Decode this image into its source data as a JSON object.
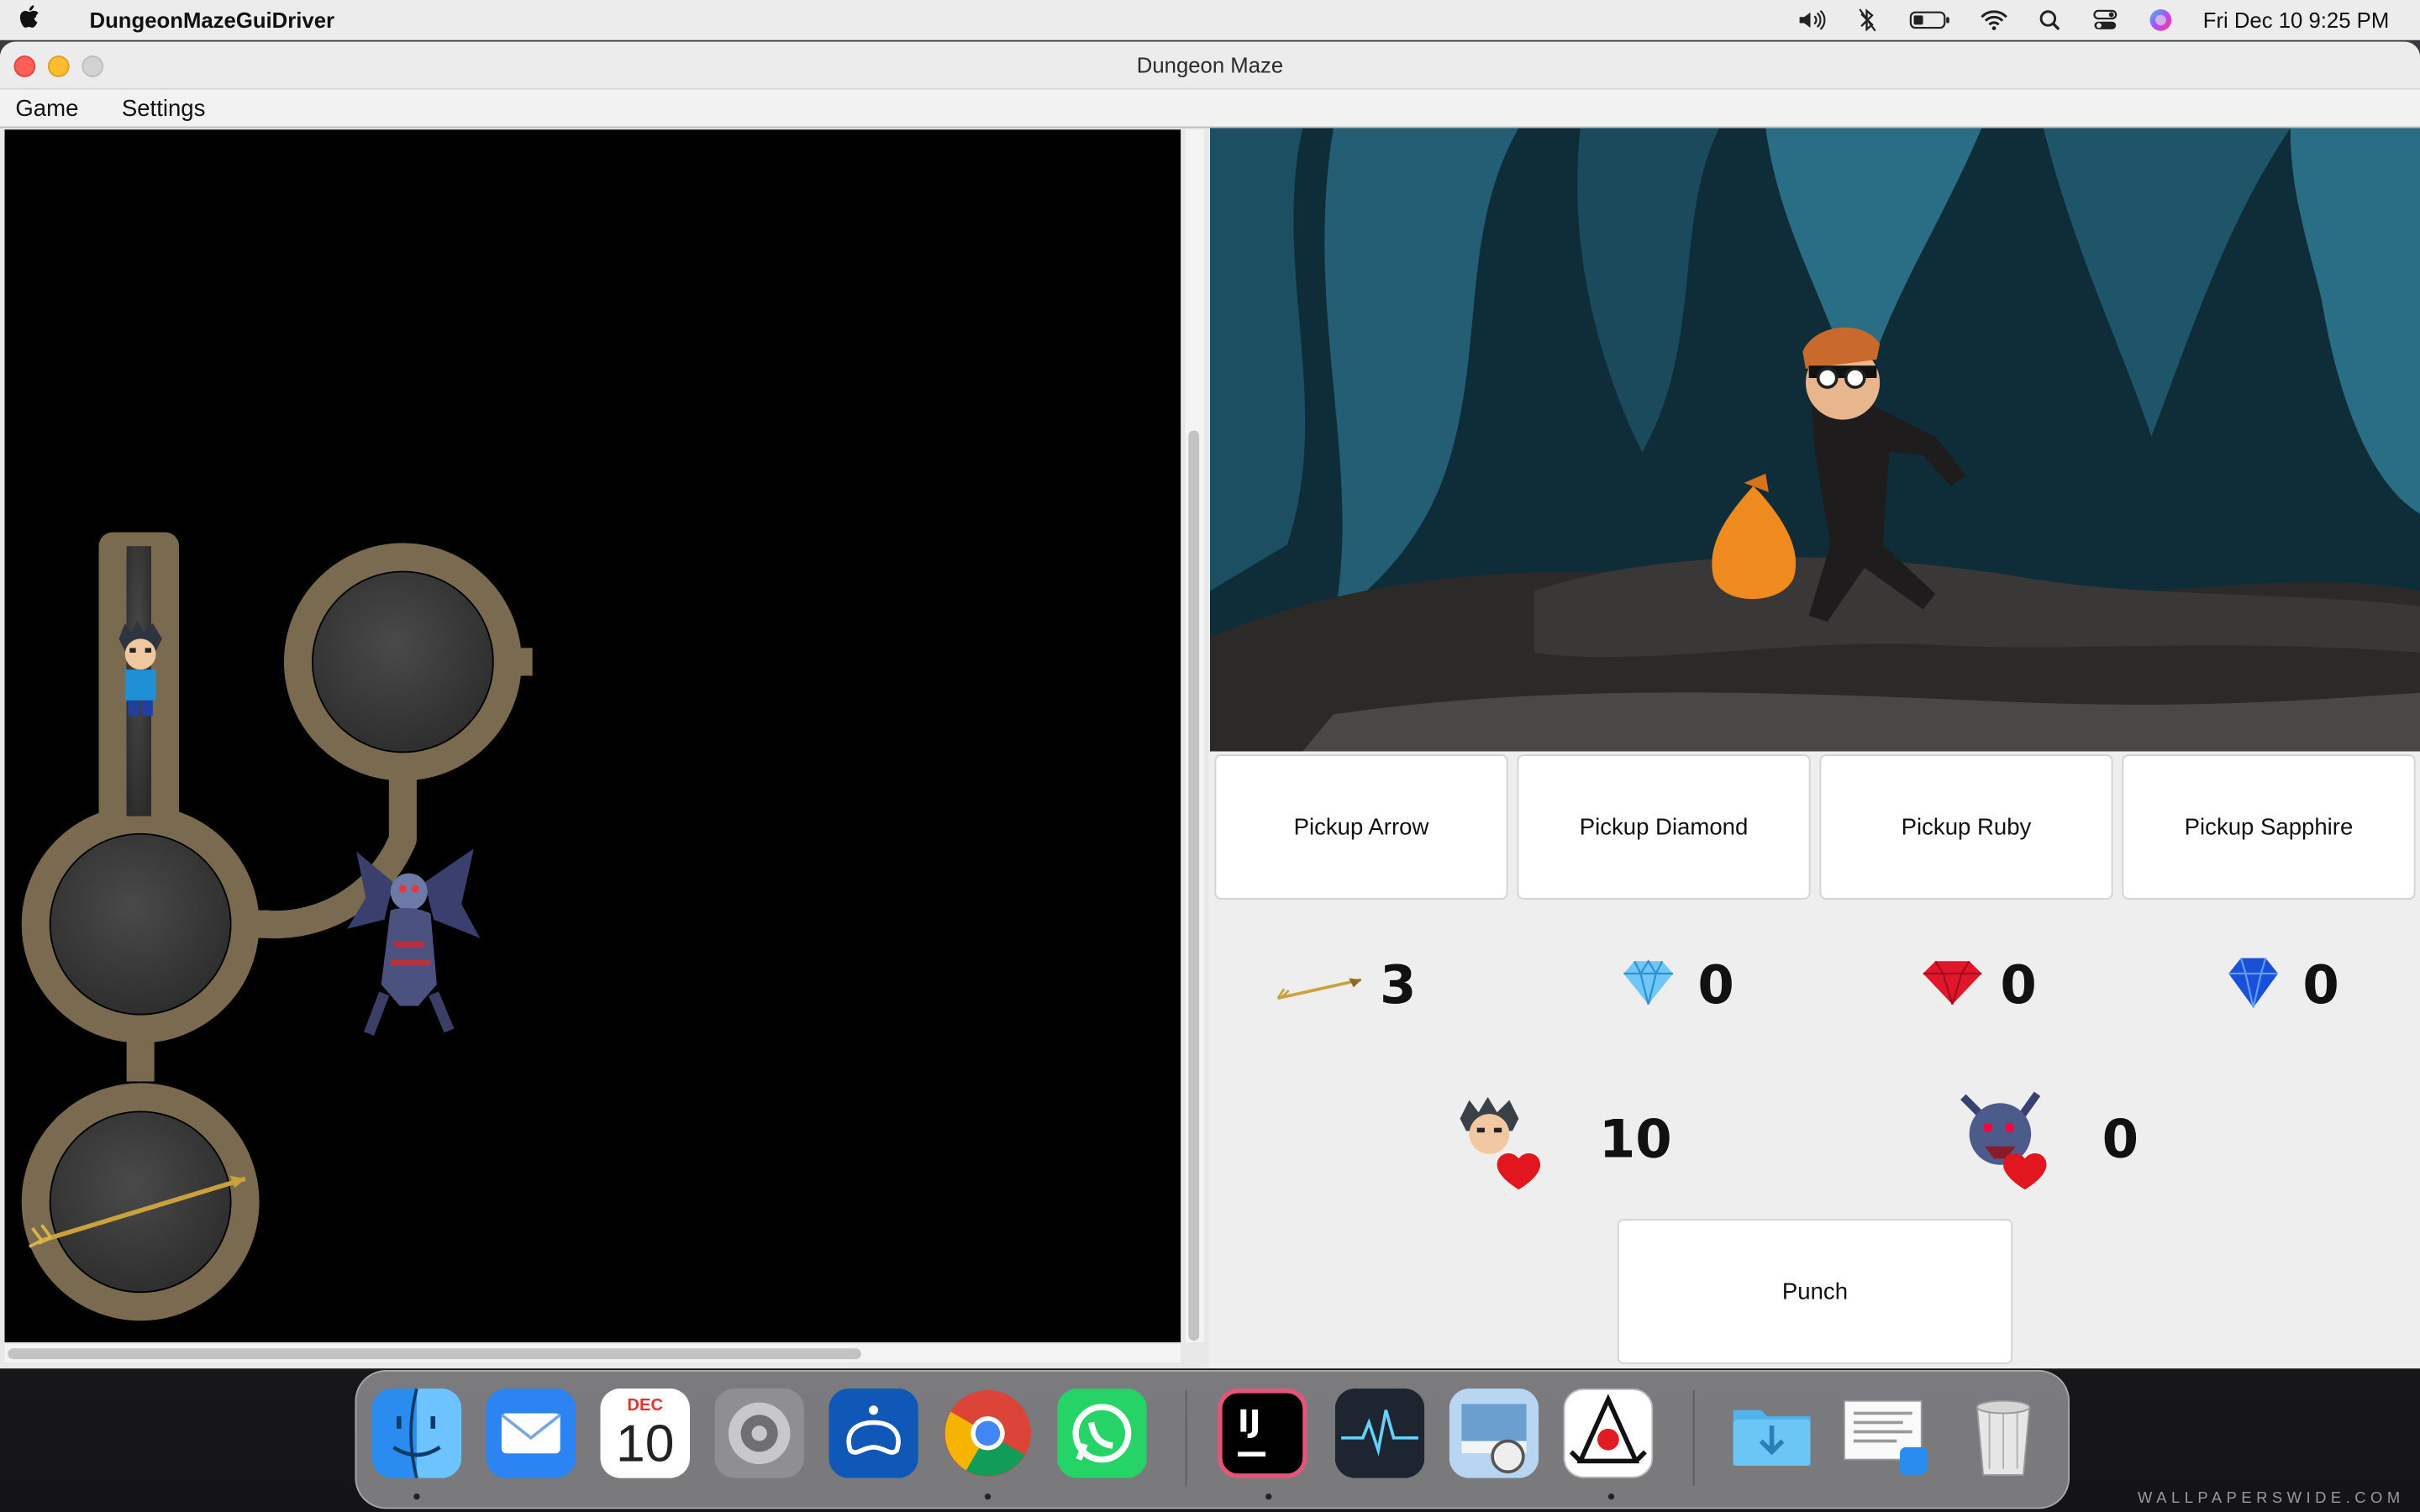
{
  "menubar": {
    "app_name": "DungeonMazeGuiDriver",
    "datetime": "Fri Dec 10  9:25 PM",
    "tray_icons": [
      "volume-icon",
      "bluetooth-icon",
      "battery-icon",
      "wifi-icon",
      "search-icon",
      "control-center-icon",
      "siri-icon"
    ]
  },
  "window": {
    "title": "Dungeon Maze",
    "menu": [
      "Game",
      "Settings"
    ]
  },
  "actions": {
    "pickup_arrow": "Pickup Arrow",
    "pickup_diamond": "Pickup Diamond",
    "pickup_ruby": "Pickup Ruby",
    "pickup_sapphire": "Pickup Sapphire",
    "punch": "Punch"
  },
  "inventory": {
    "arrows": "3",
    "diamonds": "0",
    "rubies": "0",
    "sapphires": "0"
  },
  "health": {
    "hero": "10",
    "monster": "0"
  },
  "dock": {
    "apps": [
      "Finder",
      "Mail",
      "Calendar",
      "System Preferences",
      "Steam Link",
      "Chrome",
      "WhatsApp",
      "IntelliJ IDEA",
      "Activity Monitor",
      "Preview",
      "Java",
      "Downloads Folder",
      "Documents Stack",
      "Trash"
    ],
    "calendar_month": "DEC",
    "calendar_day": "10",
    "intellij_label": "IJ"
  },
  "watermark": "WALLPAPERSWIDE.COM",
  "colors": {
    "menubar": "#ececec",
    "maze_bg": "#000000",
    "cave_dark": "#0e2a36",
    "cave_light": "#2a6e86",
    "button_bg": "#ffffff"
  }
}
